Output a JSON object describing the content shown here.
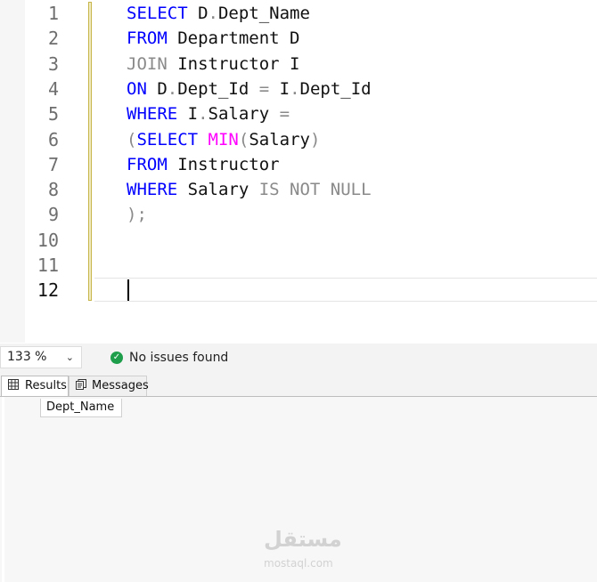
{
  "editor": {
    "line_numbers": [
      "1",
      "2",
      "3",
      "4",
      "5",
      "6",
      "7",
      "8",
      "9",
      "10",
      "11",
      "12"
    ],
    "lines": [
      [
        {
          "t": "SELECT ",
          "c": "#0000ff"
        },
        {
          "t": "D",
          "c": "#111111"
        },
        {
          "t": ".",
          "c": "#8a8a8a"
        },
        {
          "t": "Dept_Name",
          "c": "#111111"
        }
      ],
      [
        {
          "t": "FROM ",
          "c": "#0000ff"
        },
        {
          "t": "Department D",
          "c": "#111111"
        }
      ],
      [
        {
          "t": "JOIN ",
          "c": "#8a8a8a"
        },
        {
          "t": "Instructor I",
          "c": "#111111"
        }
      ],
      [
        {
          "t": "ON ",
          "c": "#0000ff"
        },
        {
          "t": "D",
          "c": "#111111"
        },
        {
          "t": ".",
          "c": "#8a8a8a"
        },
        {
          "t": "Dept_Id ",
          "c": "#111111"
        },
        {
          "t": "=",
          "c": "#8a8a8a"
        },
        {
          "t": " I",
          "c": "#111111"
        },
        {
          "t": ".",
          "c": "#8a8a8a"
        },
        {
          "t": "Dept_Id",
          "c": "#111111"
        }
      ],
      [
        {
          "t": "WHERE ",
          "c": "#0000ff"
        },
        {
          "t": "I",
          "c": "#111111"
        },
        {
          "t": ".",
          "c": "#8a8a8a"
        },
        {
          "t": "Salary ",
          "c": "#111111"
        },
        {
          "t": "=",
          "c": "#8a8a8a"
        }
      ],
      [
        {
          "t": "(",
          "c": "#8a8a8a"
        },
        {
          "t": "SELECT ",
          "c": "#0000ff"
        },
        {
          "t": "MIN",
          "c": "#ff00ff"
        },
        {
          "t": "(",
          "c": "#8a8a8a"
        },
        {
          "t": "Salary",
          "c": "#111111"
        },
        {
          "t": ")",
          "c": "#8a8a8a"
        }
      ],
      [
        {
          "t": "FROM ",
          "c": "#0000ff"
        },
        {
          "t": "Instructor",
          "c": "#111111"
        }
      ],
      [
        {
          "t": "WHERE ",
          "c": "#0000ff"
        },
        {
          "t": "Salary ",
          "c": "#111111"
        },
        {
          "t": "IS NOT NULL",
          "c": "#8a8a8a"
        }
      ],
      [
        {
          "t": ");",
          "c": "#8a8a8a"
        }
      ],
      [],
      [],
      []
    ]
  },
  "statusbar": {
    "zoom": "133 %",
    "issues": "No issues found"
  },
  "tabs": {
    "results": "Results",
    "messages": "Messages"
  },
  "grid": {
    "columns": [
      "Dept_Name"
    ]
  },
  "watermark": {
    "arabic": "مستقل",
    "latin": "mostaql.com"
  }
}
